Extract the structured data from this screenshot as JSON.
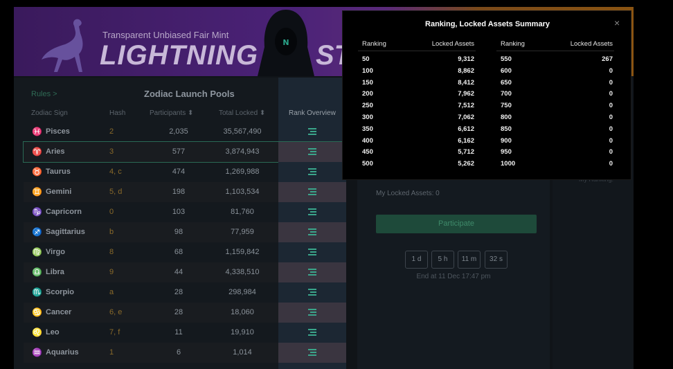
{
  "banner": {
    "tagline": "Transparent Unbiased Fair Mint",
    "title_left": "LIGHTNING",
    "title_right": "ST"
  },
  "pools": {
    "rules_label": "Rules >",
    "title": "Zodiac Launch Pools",
    "columns": {
      "sign": "Zodiac Sign",
      "hash": "Hash",
      "participants": "Participants ⬍",
      "locked": "Total Locked ⬍",
      "rank": "Rank Overview"
    },
    "rows": [
      {
        "icon": "pisces-icon",
        "glyph": "♓",
        "sign": "Pisces",
        "hash": "2",
        "participants": "2,035",
        "locked": "35,567,490"
      },
      {
        "icon": "aries-icon",
        "glyph": "♈",
        "sign": "Aries",
        "hash": "3",
        "participants": "577",
        "locked": "3,874,943"
      },
      {
        "icon": "taurus-icon",
        "glyph": "♉",
        "sign": "Taurus",
        "hash": "4, c",
        "participants": "474",
        "locked": "1,269,988"
      },
      {
        "icon": "gemini-icon",
        "glyph": "♊",
        "sign": "Gemini",
        "hash": "5, d",
        "participants": "198",
        "locked": "1,103,534"
      },
      {
        "icon": "capricorn-icon",
        "glyph": "♑",
        "sign": "Capricorn",
        "hash": "0",
        "participants": "103",
        "locked": "81,760"
      },
      {
        "icon": "sagittarius-icon",
        "glyph": "♐",
        "sign": "Sagittarius",
        "hash": "b",
        "participants": "98",
        "locked": "77,959"
      },
      {
        "icon": "virgo-icon",
        "glyph": "♍",
        "sign": "Virgo",
        "hash": "8",
        "participants": "68",
        "locked": "1,159,842"
      },
      {
        "icon": "libra-icon",
        "glyph": "♎",
        "sign": "Libra",
        "hash": "9",
        "participants": "44",
        "locked": "4,338,510"
      },
      {
        "icon": "scorpio-icon",
        "glyph": "♏",
        "sign": "Scorpio",
        "hash": "a",
        "participants": "28",
        "locked": "298,984"
      },
      {
        "icon": "cancer-icon",
        "glyph": "♋",
        "sign": "Cancer",
        "hash": "6, e",
        "participants": "28",
        "locked": "18,060"
      },
      {
        "icon": "leo-icon",
        "glyph": "♌",
        "sign": "Leo",
        "hash": "7, f",
        "participants": "11",
        "locked": "19,910"
      },
      {
        "icon": "aquarius-icon",
        "glyph": "♒",
        "sign": "Aquarius",
        "hash": "1",
        "participants": "6",
        "locked": "1,014"
      }
    ]
  },
  "detail": {
    "my_locked": "My Locked Assets:  0",
    "participate_label": "Participate",
    "timer": [
      "1 d",
      "5 h",
      "11 m",
      "32 s"
    ],
    "end_at": "End at 11 Dec 17:47 pm",
    "my_ranking": "My Ranking:"
  },
  "modal": {
    "title": "Ranking, Locked Assets Summary",
    "close_glyph": "×",
    "col_ranking": "Ranking",
    "col_locked": "Locked Assets",
    "left_rows": [
      {
        "rank": "50",
        "locked": "9,312"
      },
      {
        "rank": "100",
        "locked": "8,862"
      },
      {
        "rank": "150",
        "locked": "8,412"
      },
      {
        "rank": "200",
        "locked": "7,962"
      },
      {
        "rank": "250",
        "locked": "7,512"
      },
      {
        "rank": "300",
        "locked": "7,062"
      },
      {
        "rank": "350",
        "locked": "6,612"
      },
      {
        "rank": "400",
        "locked": "6,162"
      },
      {
        "rank": "450",
        "locked": "5,712"
      },
      {
        "rank": "500",
        "locked": "5,262"
      }
    ],
    "right_rows": [
      {
        "rank": "550",
        "locked": "267"
      },
      {
        "rank": "600",
        "locked": "0"
      },
      {
        "rank": "650",
        "locked": "0"
      },
      {
        "rank": "700",
        "locked": "0"
      },
      {
        "rank": "750",
        "locked": "0"
      },
      {
        "rank": "800",
        "locked": "0"
      },
      {
        "rank": "850",
        "locked": "0"
      },
      {
        "rank": "900",
        "locked": "0"
      },
      {
        "rank": "950",
        "locked": "0"
      },
      {
        "rank": "1000",
        "locked": "0"
      }
    ]
  }
}
